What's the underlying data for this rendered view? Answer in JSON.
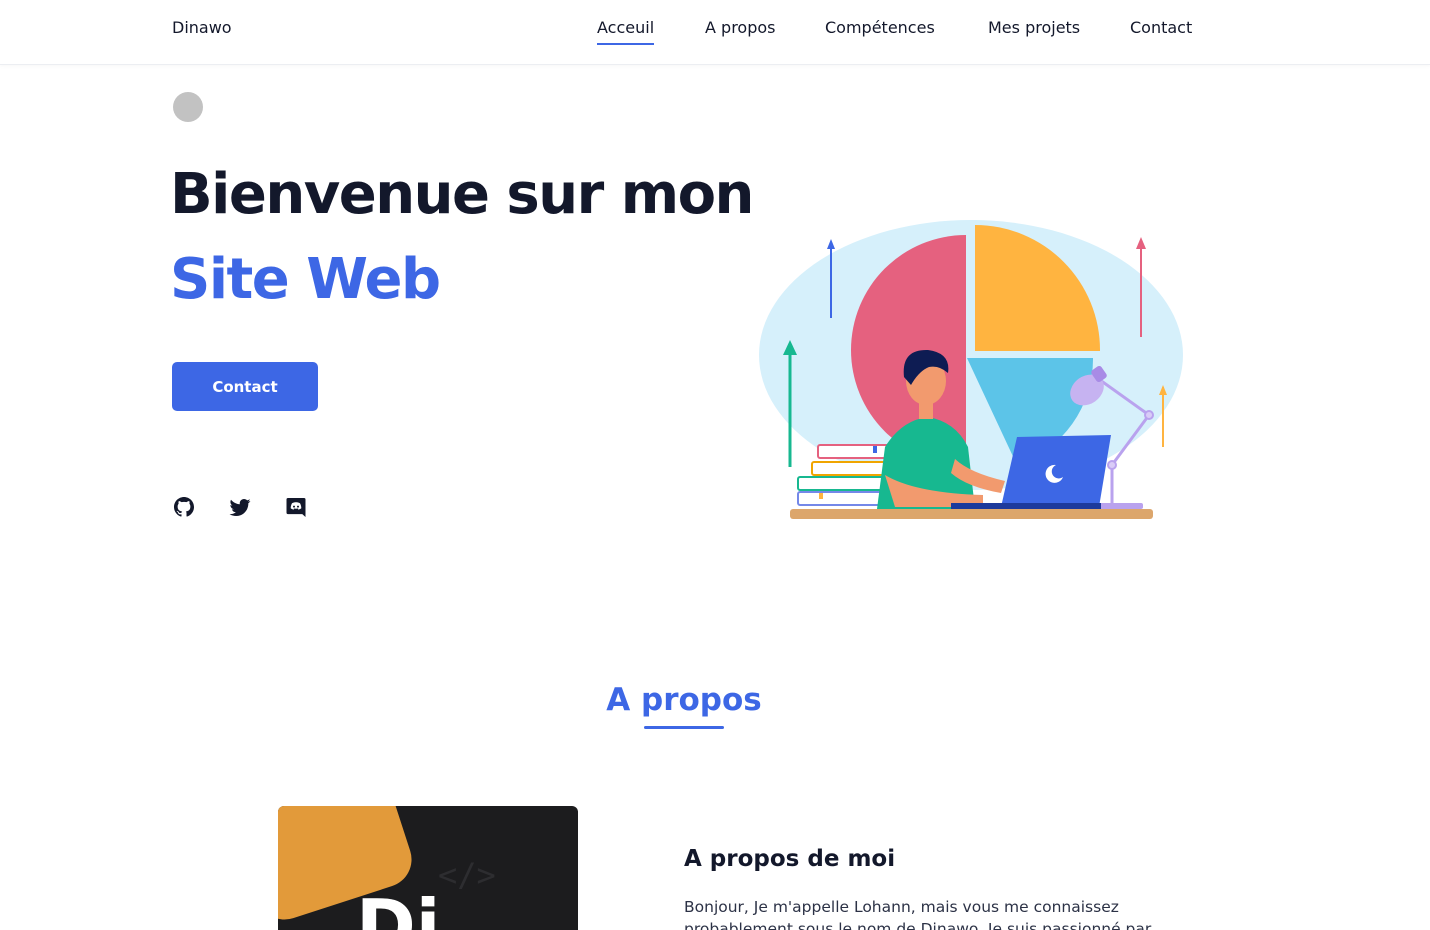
{
  "header": {
    "logo": "Dinawo",
    "nav": [
      {
        "label": "Acceuil",
        "active": true
      },
      {
        "label": "A propos",
        "active": false
      },
      {
        "label": "Compétences",
        "active": false
      },
      {
        "label": "Mes projets",
        "active": false
      },
      {
        "label": "Contact",
        "active": false
      }
    ]
  },
  "hero": {
    "title_line1": "Bienvenue sur mon",
    "title_line2": "Site Web",
    "contact_button": "Contact",
    "social": [
      {
        "icon": "github-icon"
      },
      {
        "icon": "twitter-icon"
      },
      {
        "icon": "discord-icon"
      }
    ],
    "illustration": "person-at-laptop-illustration"
  },
  "about": {
    "section_title": "A propos",
    "heading": "A propos de moi",
    "text": "Bonjour, Je m'appelle Lohann, mais vous me connaissez probablement sous le nom de Dinawo. Je suis passionné par"
  },
  "colors": {
    "accent": "#3d67e5",
    "text_dark": "#13182b",
    "toggle_gray": "#c2c2c2"
  }
}
